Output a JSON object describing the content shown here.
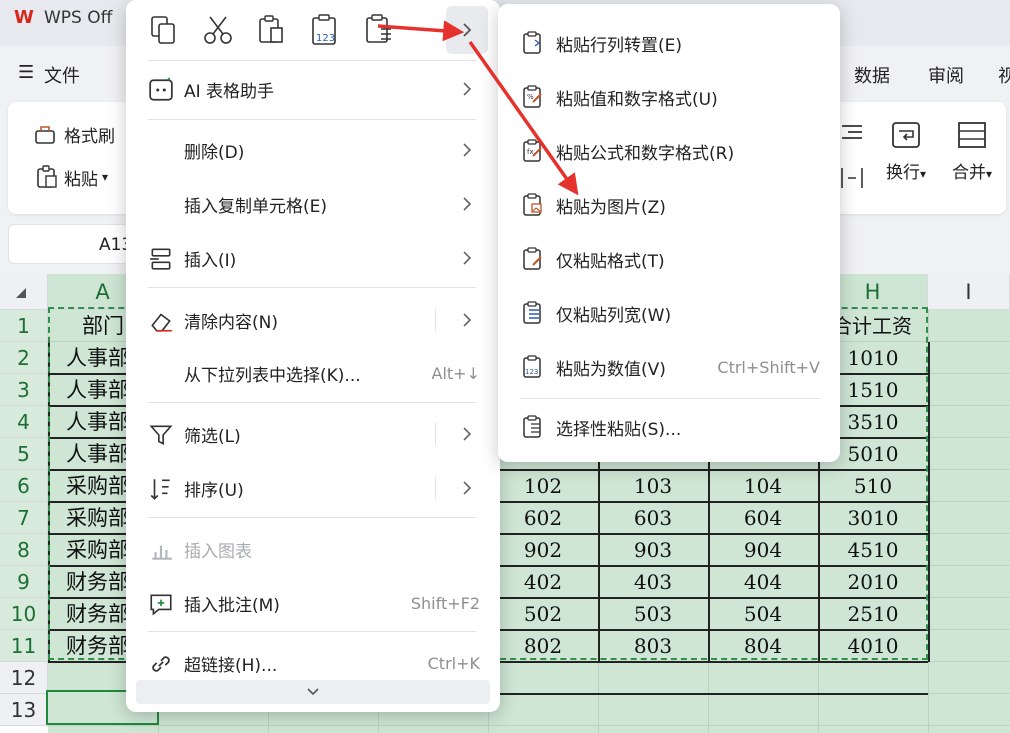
{
  "app": {
    "title": "WPS Off"
  },
  "menubar": {
    "file": "文件",
    "data": "数据",
    "review": "审阅",
    "view_partial": "视"
  },
  "ribbon": {
    "format_painter": "格式刷",
    "paste": "粘贴",
    "wrap": "换行",
    "merge": "合并"
  },
  "namebox": {
    "value": "A13"
  },
  "columns": [
    "A",
    "H",
    "I"
  ],
  "rows": [
    "1",
    "2",
    "3",
    "4",
    "5",
    "6",
    "7",
    "8",
    "9",
    "10",
    "11",
    "12",
    "13"
  ],
  "sheet": {
    "dept_header": "部门",
    "total_header": "合计工资",
    "dept_rows": [
      "人事部",
      "人事部",
      "人事部",
      "人事部",
      "采购部",
      "采购部",
      "采购部",
      "财务部",
      "财务部",
      "财务部"
    ],
    "visible_rows": [
      [
        "102",
        "103",
        "104",
        "510"
      ],
      [
        "602",
        "603",
        "604",
        "3010"
      ],
      [
        "902",
        "903",
        "904",
        "4510"
      ],
      [
        "402",
        "403",
        "404",
        "2010"
      ],
      [
        "502",
        "503",
        "504",
        "2510"
      ],
      [
        "802",
        "803",
        "804",
        "4010"
      ]
    ],
    "total_rows_top": [
      "1010",
      "1510",
      "3510",
      "5010"
    ]
  },
  "context_menu": {
    "items": [
      {
        "label": "AI 表格助手",
        "icon": "ai-icon",
        "submenu": true
      },
      {
        "label": "删除(D)",
        "submenu": true
      },
      {
        "label": "插入复制单元格(E)",
        "submenu": true
      },
      {
        "label": "插入(I)",
        "icon": "insert-icon",
        "submenu": true
      },
      {
        "label": "清除内容(N)",
        "icon": "eraser-icon",
        "submenu": true
      },
      {
        "label": "从下拉列表中选择(K)...",
        "shortcut": "Alt+↓"
      },
      {
        "label": "筛选(L)",
        "icon": "filter-icon",
        "submenu": true
      },
      {
        "label": "排序(U)",
        "icon": "sort-icon",
        "submenu": true
      },
      {
        "label": "插入图表",
        "icon": "chart-icon",
        "disabled": true
      },
      {
        "label": "插入批注(M)",
        "icon": "comment-icon",
        "shortcut": "Shift+F2"
      },
      {
        "label": "超链接(H)...",
        "icon": "link-icon",
        "shortcut": "Ctrl+K"
      }
    ]
  },
  "paste_submenu": {
    "items": [
      {
        "label": "粘贴行列转置(E)"
      },
      {
        "label": "粘贴值和数字格式(U)"
      },
      {
        "label": "粘贴公式和数字格式(R)"
      },
      {
        "label": "粘贴为图片(Z)"
      },
      {
        "label": "仅粘贴格式(T)"
      },
      {
        "label": "仅粘贴列宽(W)"
      },
      {
        "label": "粘贴为数值(V)",
        "shortcut": "Ctrl+Shift+V"
      },
      {
        "label": "选择性粘贴(S)..."
      }
    ]
  },
  "colors": {
    "accent": "#1f8a3d",
    "selection": "#cfe6d4",
    "annotation_arrow": "#e5322d",
    "brand": "#d9261c"
  }
}
